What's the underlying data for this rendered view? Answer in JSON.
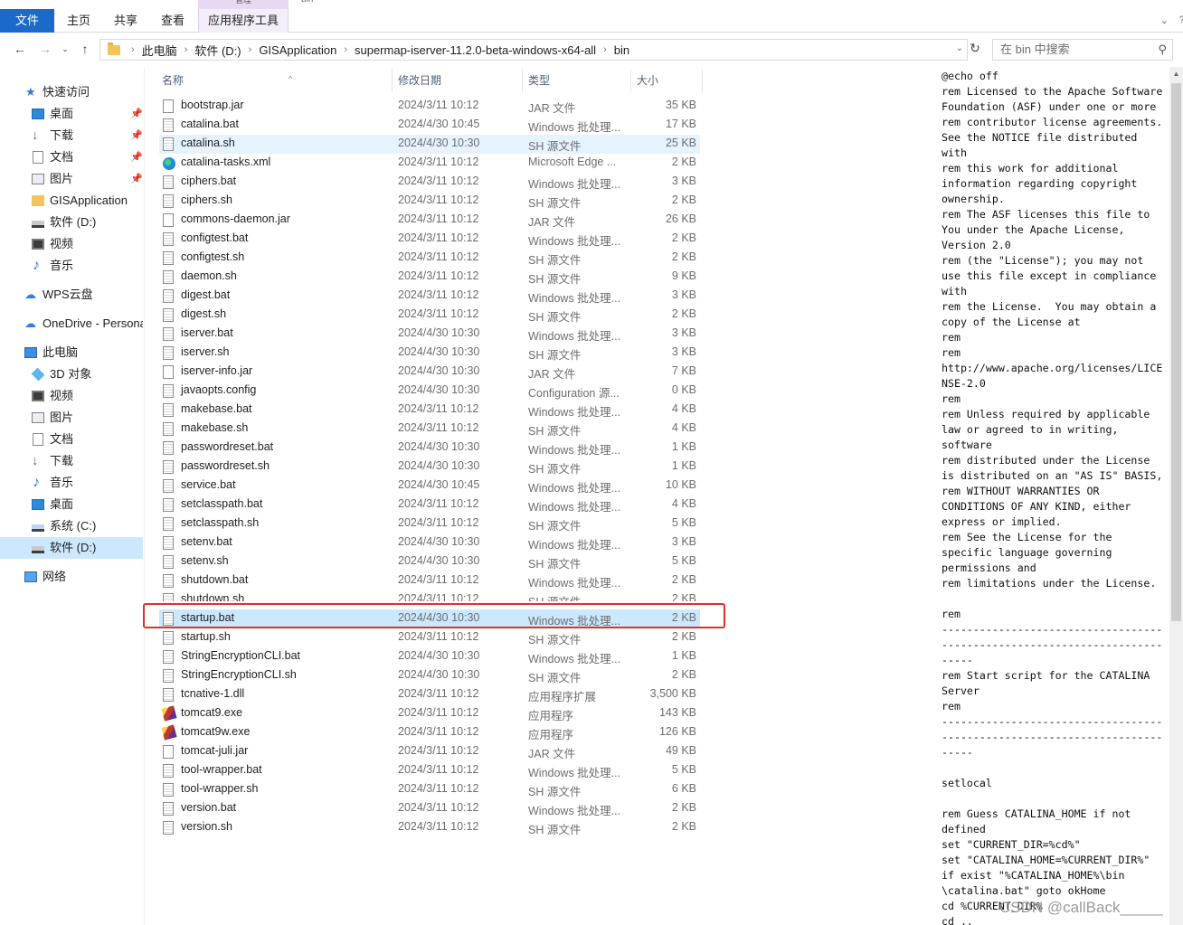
{
  "ribbon": {
    "context_label": "管理",
    "tabs": [
      "文件",
      "主页",
      "共享",
      "查看",
      "应用程序工具"
    ],
    "window_title_partial": "bin"
  },
  "address": {
    "crumbs": [
      "此电脑",
      "软件 (D:)",
      "GISApplication",
      "supermap-iserver-11.2.0-beta-windows-x64-all",
      "bin"
    ],
    "search_placeholder": "在 bin 中搜索"
  },
  "sidebar": {
    "items": [
      {
        "label": "快速访问",
        "icon": "star-icon"
      },
      {
        "label": "桌面",
        "icon": "desktop-icon",
        "pinned": true
      },
      {
        "label": "下载",
        "icon": "download-icon",
        "pinned": true
      },
      {
        "label": "文档",
        "icon": "document-icon",
        "pinned": true
      },
      {
        "label": "图片",
        "icon": "picture-icon",
        "pinned": true
      },
      {
        "label": "GISApplication",
        "icon": "folder-icon"
      },
      {
        "label": "软件 (D:)",
        "icon": "drive-icon"
      },
      {
        "label": "视频",
        "icon": "video-icon"
      },
      {
        "label": "音乐",
        "icon": "music-icon"
      },
      {
        "label": "WPS云盘",
        "icon": "cloud-icon"
      },
      {
        "label": "OneDrive - Persona",
        "icon": "onedrive-icon"
      },
      {
        "label": "此电脑",
        "icon": "computer-icon"
      },
      {
        "label": "3D 对象",
        "icon": "3d-objects-icon"
      },
      {
        "label": "视频",
        "icon": "video-icon"
      },
      {
        "label": "图片",
        "icon": "picture-icon"
      },
      {
        "label": "文档",
        "icon": "document-icon"
      },
      {
        "label": "下载",
        "icon": "download-icon"
      },
      {
        "label": "音乐",
        "icon": "music-icon"
      },
      {
        "label": "桌面",
        "icon": "desktop-icon"
      },
      {
        "label": "系统 (C:)",
        "icon": "system-drive-icon"
      },
      {
        "label": "软件 (D:)",
        "icon": "drive-icon",
        "selected": true
      },
      {
        "label": "网络",
        "icon": "network-icon"
      }
    ]
  },
  "columns": {
    "name": "名称",
    "date": "修改日期",
    "type": "类型",
    "size": "大小"
  },
  "files": [
    {
      "name": "bootstrap.jar",
      "date": "2024/3/11 10:12",
      "type": "JAR 文件",
      "size": "35 KB",
      "icon": "jar-file-icon"
    },
    {
      "name": "catalina.bat",
      "date": "2024/4/30 10:45",
      "type": "Windows 批处理...",
      "size": "17 KB",
      "icon": "batch-file-icon"
    },
    {
      "name": "catalina.sh",
      "date": "2024/4/30 10:30",
      "type": "SH 源文件",
      "size": "25 KB",
      "icon": "sh-file-icon",
      "state": "hover"
    },
    {
      "name": "catalina-tasks.xml",
      "date": "2024/3/11 10:12",
      "type": "Microsoft Edge ...",
      "size": "2 KB",
      "icon": "edge-icon"
    },
    {
      "name": "ciphers.bat",
      "date": "2024/3/11 10:12",
      "type": "Windows 批处理...",
      "size": "3 KB",
      "icon": "batch-file-icon"
    },
    {
      "name": "ciphers.sh",
      "date": "2024/3/11 10:12",
      "type": "SH 源文件",
      "size": "2 KB",
      "icon": "sh-file-icon"
    },
    {
      "name": "commons-daemon.jar",
      "date": "2024/3/11 10:12",
      "type": "JAR 文件",
      "size": "26 KB",
      "icon": "jar-file-icon"
    },
    {
      "name": "configtest.bat",
      "date": "2024/3/11 10:12",
      "type": "Windows 批处理...",
      "size": "2 KB",
      "icon": "batch-file-icon"
    },
    {
      "name": "configtest.sh",
      "date": "2024/3/11 10:12",
      "type": "SH 源文件",
      "size": "2 KB",
      "icon": "sh-file-icon"
    },
    {
      "name": "daemon.sh",
      "date": "2024/3/11 10:12",
      "type": "SH 源文件",
      "size": "9 KB",
      "icon": "sh-file-icon"
    },
    {
      "name": "digest.bat",
      "date": "2024/3/11 10:12",
      "type": "Windows 批处理...",
      "size": "3 KB",
      "icon": "batch-file-icon"
    },
    {
      "name": "digest.sh",
      "date": "2024/3/11 10:12",
      "type": "SH 源文件",
      "size": "2 KB",
      "icon": "sh-file-icon"
    },
    {
      "name": "iserver.bat",
      "date": "2024/4/30 10:30",
      "type": "Windows 批处理...",
      "size": "3 KB",
      "icon": "batch-file-icon"
    },
    {
      "name": "iserver.sh",
      "date": "2024/4/30 10:30",
      "type": "SH 源文件",
      "size": "3 KB",
      "icon": "sh-file-icon"
    },
    {
      "name": "iserver-info.jar",
      "date": "2024/4/30 10:30",
      "type": "JAR 文件",
      "size": "7 KB",
      "icon": "jar-file-icon"
    },
    {
      "name": "javaopts.config",
      "date": "2024/4/30 10:30",
      "type": "Configuration 源...",
      "size": "0 KB",
      "icon": "config-file-icon"
    },
    {
      "name": "makebase.bat",
      "date": "2024/3/11 10:12",
      "type": "Windows 批处理...",
      "size": "4 KB",
      "icon": "batch-file-icon"
    },
    {
      "name": "makebase.sh",
      "date": "2024/3/11 10:12",
      "type": "SH 源文件",
      "size": "4 KB",
      "icon": "sh-file-icon"
    },
    {
      "name": "passwordreset.bat",
      "date": "2024/4/30 10:30",
      "type": "Windows 批处理...",
      "size": "1 KB",
      "icon": "batch-file-icon"
    },
    {
      "name": "passwordreset.sh",
      "date": "2024/4/30 10:30",
      "type": "SH 源文件",
      "size": "1 KB",
      "icon": "sh-file-icon"
    },
    {
      "name": "service.bat",
      "date": "2024/4/30 10:45",
      "type": "Windows 批处理...",
      "size": "10 KB",
      "icon": "batch-file-icon"
    },
    {
      "name": "setclasspath.bat",
      "date": "2024/3/11 10:12",
      "type": "Windows 批处理...",
      "size": "4 KB",
      "icon": "batch-file-icon"
    },
    {
      "name": "setclasspath.sh",
      "date": "2024/3/11 10:12",
      "type": "SH 源文件",
      "size": "5 KB",
      "icon": "sh-file-icon"
    },
    {
      "name": "setenv.bat",
      "date": "2024/4/30 10:30",
      "type": "Windows 批处理...",
      "size": "3 KB",
      "icon": "batch-file-icon"
    },
    {
      "name": "setenv.sh",
      "date": "2024/4/30 10:30",
      "type": "SH 源文件",
      "size": "5 KB",
      "icon": "sh-file-icon"
    },
    {
      "name": "shutdown.bat",
      "date": "2024/3/11 10:12",
      "type": "Windows 批处理...",
      "size": "2 KB",
      "icon": "batch-file-icon"
    },
    {
      "name": "shutdown.sh",
      "date": "2024/3/11 10:12",
      "type": "SH 源文件",
      "size": "2 KB",
      "icon": "sh-file-icon",
      "state": "clipped"
    },
    {
      "name": "startup.bat",
      "date": "2024/4/30 10:30",
      "type": "Windows 批处理...",
      "size": "2 KB",
      "icon": "batch-file-icon",
      "state": "selected"
    },
    {
      "name": "startup.sh",
      "date": "2024/3/11 10:12",
      "type": "SH 源文件",
      "size": "2 KB",
      "icon": "sh-file-icon"
    },
    {
      "name": "StringEncryptionCLI.bat",
      "date": "2024/4/30 10:30",
      "type": "Windows 批处理...",
      "size": "1 KB",
      "icon": "batch-file-icon"
    },
    {
      "name": "StringEncryptionCLI.sh",
      "date": "2024/4/30 10:30",
      "type": "SH 源文件",
      "size": "2 KB",
      "icon": "sh-file-icon"
    },
    {
      "name": "tcnative-1.dll",
      "date": "2024/3/11 10:12",
      "type": "应用程序扩展",
      "size": "3,500 KB",
      "icon": "dll-file-icon"
    },
    {
      "name": "tomcat9.exe",
      "date": "2024/3/11 10:12",
      "type": "应用程序",
      "size": "143 KB",
      "icon": "tomcat-exe-icon"
    },
    {
      "name": "tomcat9w.exe",
      "date": "2024/3/11 10:12",
      "type": "应用程序",
      "size": "126 KB",
      "icon": "tomcat-exe-icon"
    },
    {
      "name": "tomcat-juli.jar",
      "date": "2024/3/11 10:12",
      "type": "JAR 文件",
      "size": "49 KB",
      "icon": "jar-file-icon"
    },
    {
      "name": "tool-wrapper.bat",
      "date": "2024/3/11 10:12",
      "type": "Windows 批处理...",
      "size": "5 KB",
      "icon": "batch-file-icon"
    },
    {
      "name": "tool-wrapper.sh",
      "date": "2024/3/11 10:12",
      "type": "SH 源文件",
      "size": "6 KB",
      "icon": "sh-file-icon"
    },
    {
      "name": "version.bat",
      "date": "2024/3/11 10:12",
      "type": "Windows 批处理...",
      "size": "2 KB",
      "icon": "batch-file-icon"
    },
    {
      "name": "version.sh",
      "date": "2024/3/11 10:12",
      "type": "SH 源文件",
      "size": "2 KB",
      "icon": "sh-file-icon"
    }
  ],
  "preview_lines": [
    "@echo off",
    "rem Licensed to the Apache Software",
    "Foundation (ASF) under one or more",
    "rem contributor license agreements.",
    "See the NOTICE file distributed",
    "with",
    "rem this work for additional",
    "information regarding copyright",
    "ownership.",
    "rem The ASF licenses this file to",
    "You under the Apache License,",
    "Version 2.0",
    "rem (the \"License\"); you may not",
    "use this file except in compliance",
    "with",
    "rem the License.  You may obtain a",
    "copy of the License at",
    "rem",
    "rem",
    "http://www.apache.org/licenses/LICE",
    "NSE-2.0",
    "rem",
    "rem Unless required by applicable",
    "law or agreed to in writing,",
    "software",
    "rem distributed under the License",
    "is distributed on an \"AS IS\" BASIS,",
    "rem WITHOUT WARRANTIES OR",
    "CONDITIONS OF ANY KIND, either",
    "express or implied.",
    "rem See the License for the",
    "specific language governing",
    "permissions and",
    "rem limitations under the License.",
    "",
    "rem",
    "-----------------------------------",
    "-----------------------------------",
    "-----",
    "rem Start script for the CATALINA",
    "Server",
    "rem",
    "-----------------------------------",
    "-----------------------------------",
    "-----",
    "",
    "setlocal",
    "",
    "rem Guess CATALINA_HOME if not",
    "defined",
    "set \"CURRENT_DIR=%cd%\"",
    "set \"CATALINA_HOME=%CURRENT_DIR%\"",
    "if exist \"%CATALINA_HOME%\\bin",
    "\\catalina.bat\" goto okHome",
    "cd %CURRENT_DIR%",
    "cd .."
  ],
  "watermark": "CSDN @callBack_____",
  "colors": {
    "accent": "#1b6ac9",
    "selection": "#cce8ff",
    "hover": "#e5f3ff",
    "annotation": "#e0302b"
  }
}
